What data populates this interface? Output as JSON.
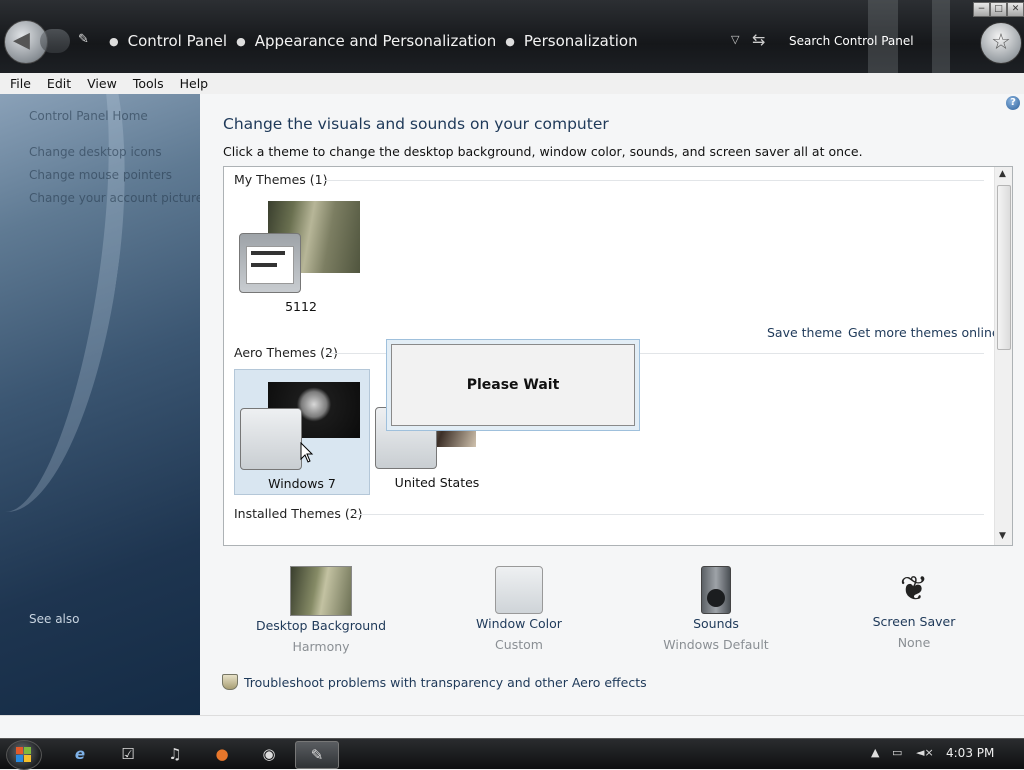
{
  "window": {
    "breadcrumb": [
      "Control Panel",
      "Appearance and Personalization",
      "Personalization"
    ],
    "search_placeholder": "Search Control Panel",
    "controls": {
      "minimize": "−",
      "maximize": "□",
      "close": "✕"
    }
  },
  "menu": [
    "File",
    "Edit",
    "View",
    "Tools",
    "Help"
  ],
  "sidebar": {
    "links": [
      "Control Panel Home",
      "Change desktop icons",
      "Change mouse pointers",
      "Change your account picture"
    ],
    "see_also": "See also"
  },
  "main": {
    "heading": "Change the visuals and sounds on your computer",
    "subheading": "Click a theme to change the desktop background, window color, sounds, and screen saver all at once.",
    "groups": {
      "my_themes": "My Themes (1)",
      "aero_themes": "Aero Themes (2)",
      "installed_themes": "Installed Themes (2)"
    },
    "themes": {
      "custom": "5112",
      "windows7": "Windows 7",
      "us": "United States"
    },
    "links": {
      "save_theme": "Save theme",
      "get_more": "Get more themes online"
    },
    "dialog": "Please Wait",
    "settings": [
      {
        "title": "Desktop Background",
        "value": "Harmony",
        "icon": "wallpaper-icon"
      },
      {
        "title": "Window Color",
        "value": "Custom",
        "icon": "window-color-icon"
      },
      {
        "title": "Sounds",
        "value": "Windows Default",
        "icon": "speaker-icon"
      },
      {
        "title": "Screen Saver",
        "value": "None",
        "icon": "screen-saver-icon"
      }
    ],
    "troubleshoot": "Troubleshoot problems with transparency and other Aero effects"
  },
  "taskbar": {
    "clock": "4:03 PM"
  }
}
